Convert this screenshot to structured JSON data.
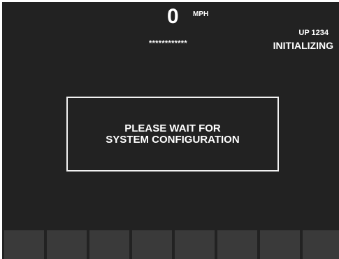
{
  "speed": {
    "value": "0",
    "unit": "MPH"
  },
  "masked_field": "************",
  "unit_id": "UP 1234",
  "status": "INITIALIZING",
  "message": {
    "line1": "PLEASE WAIT FOR",
    "line2": "SYSTEM CONFIGURATION"
  },
  "softkeys": [
    "",
    "",
    "",
    "",
    "",
    "",
    "",
    ""
  ],
  "colors": {
    "background": "#222222",
    "text": "#ffffff",
    "softkey": "#3a3a3a",
    "frame": "#ffffff"
  }
}
